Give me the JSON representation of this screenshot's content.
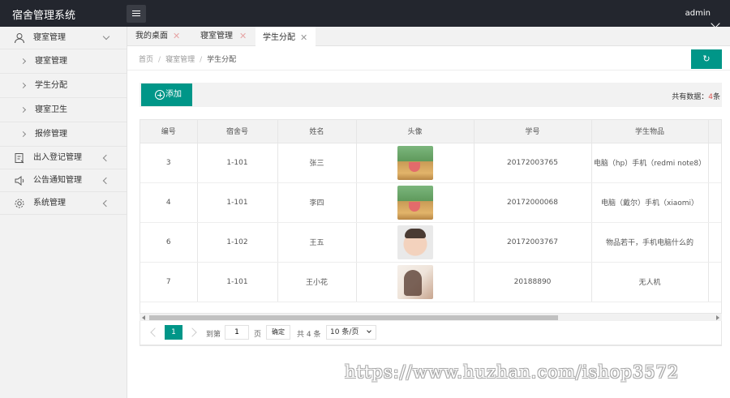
{
  "header": {
    "app_title": "宿舍管理系统",
    "user": "admin"
  },
  "sidebar": {
    "groups": [
      {
        "label": "寝室管理",
        "expanded": true,
        "icon": "user-icon",
        "items": [
          "寝室管理",
          "学生分配",
          "寝室卫生",
          "报修管理"
        ]
      },
      {
        "label": "出入登记管理",
        "icon": "clipboard-icon"
      },
      {
        "label": "公告通知管理",
        "icon": "speaker-icon"
      },
      {
        "label": "系统管理",
        "icon": "gear-icon"
      }
    ]
  },
  "tabs": [
    {
      "label": "我的桌面"
    },
    {
      "label": "寝室管理"
    },
    {
      "label": "学生分配",
      "active": true
    }
  ],
  "breadcrumb": [
    "首页",
    "寝室管理",
    "学生分配"
  ],
  "toolbar": {
    "add_label": "添加",
    "count_prefix": "共有数据：",
    "count": "4",
    "count_suffix": "条"
  },
  "table": {
    "columns": [
      "编号",
      "宿舍号",
      "姓名",
      "头像",
      "学号",
      "学生物品"
    ],
    "rows": [
      {
        "id": "3",
        "dorm": "1-101",
        "name": "张三",
        "avatar": "dog",
        "student_no": "20172003765",
        "items": "电脑（hp）手机（redmi note8）"
      },
      {
        "id": "4",
        "dorm": "1-101",
        "name": "李四",
        "avatar": "dog",
        "student_no": "20172000068",
        "items": "电脑（戴尔）手机（xiaomi）"
      },
      {
        "id": "6",
        "dorm": "1-102",
        "name": "王五",
        "avatar": "baby",
        "student_no": "20172003767",
        "items": "物品若干，手机电脑什么的"
      },
      {
        "id": "7",
        "dorm": "1-101",
        "name": "王小花",
        "avatar": "girl",
        "student_no": "20188890",
        "items": "无人机"
      }
    ]
  },
  "pager": {
    "current_page": "1",
    "goto_label": "到第",
    "page_input": "1",
    "page_unit": "页",
    "confirm_label": "确定",
    "total_label": "共 4 条",
    "page_size": "10 条/页"
  },
  "watermark": "https://www.huzhan.com/ishop3572",
  "colors": {
    "accent": "#009688",
    "topbar": "#23262e",
    "count": "#d9534f"
  }
}
